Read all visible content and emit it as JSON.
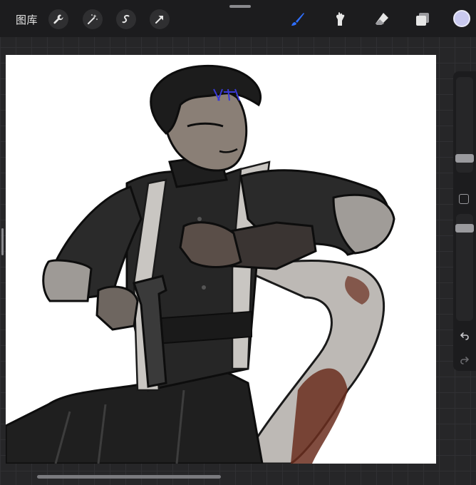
{
  "topbar": {
    "gallery_label": "图库",
    "left_tools": [
      {
        "icon": "wrench-icon",
        "name": "actions"
      },
      {
        "icon": "magic-wand-icon",
        "name": "adjustments"
      },
      {
        "icon": "selection-icon",
        "name": "selection"
      },
      {
        "icon": "transform-arrow-icon",
        "name": "transform"
      }
    ],
    "right_tools": [
      {
        "icon": "brush-icon",
        "name": "paint",
        "active": true
      },
      {
        "icon": "smudge-icon",
        "name": "smudge",
        "active": false
      },
      {
        "icon": "eraser-icon",
        "name": "eraser",
        "active": false
      },
      {
        "icon": "layers-icon",
        "name": "layers",
        "active": false
      }
    ],
    "current_color": "#c9c9ef",
    "accent_color": "#2f6fff"
  },
  "canvas": {
    "artwork": "illustration",
    "background": "#ffffff"
  },
  "sidebar": {
    "brush_size_level": 0.45,
    "opacity_level": 0.2,
    "modify_button": "square-icon",
    "undo_icon": "undo-icon",
    "redo_icon": "redo-icon"
  }
}
